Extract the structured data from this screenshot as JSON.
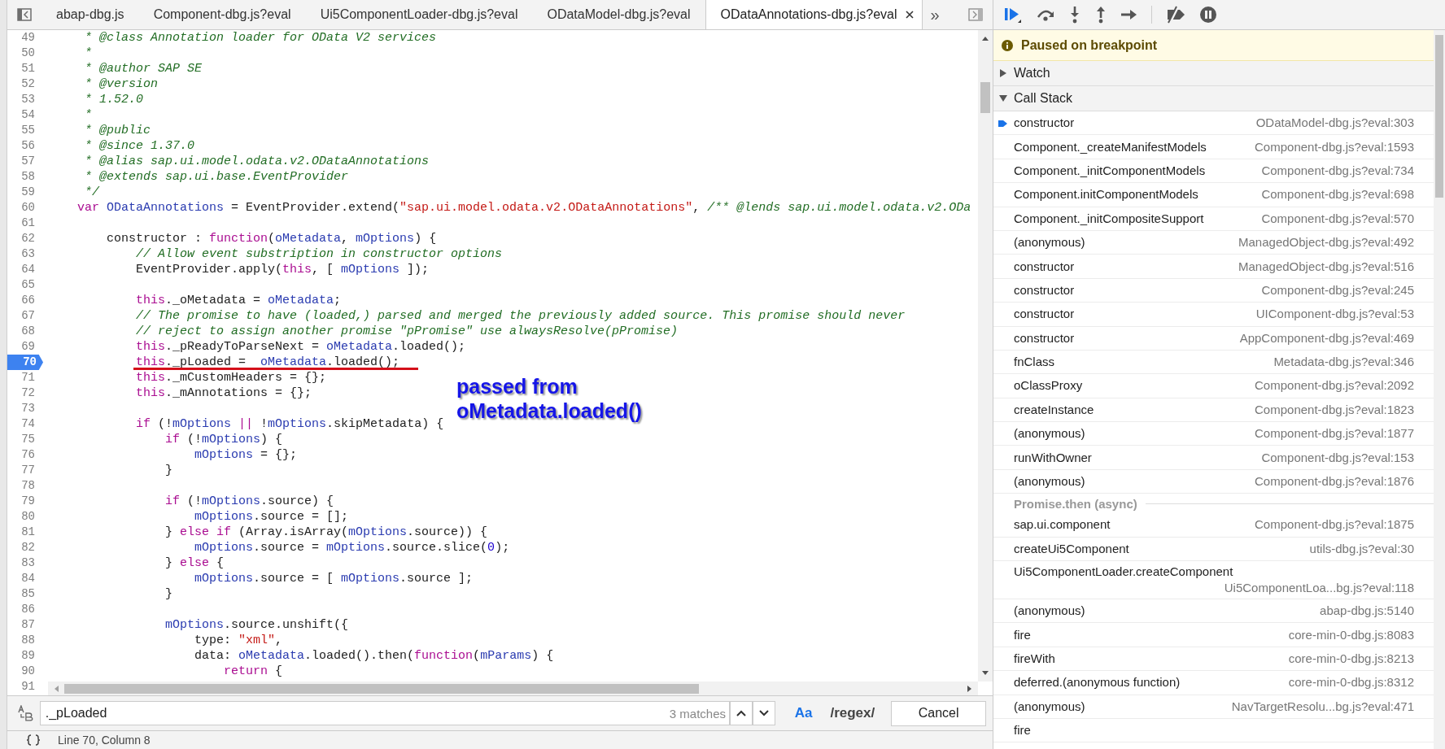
{
  "tabs": [
    {
      "label": "abap-dbg.js",
      "selected": false
    },
    {
      "label": "Component-dbg.js?eval",
      "selected": false
    },
    {
      "label": "Ui5ComponentLoader-dbg.js?eval",
      "selected": false
    },
    {
      "label": "ODataModel-dbg.js?eval",
      "selected": false
    },
    {
      "label": "ODataAnnotations-dbg.js?eval",
      "selected": true
    }
  ],
  "tab_overflow": "»",
  "editor": {
    "lines": [
      {
        "number": "49",
        "breakpoint": false,
        "tokens": [
          {
            "kind": "comment",
            "text": "     * @class Annotation loader for OData V2 services"
          }
        ]
      },
      {
        "number": "50",
        "breakpoint": false,
        "tokens": [
          {
            "kind": "comment",
            "text": "     *"
          }
        ]
      },
      {
        "number": "51",
        "breakpoint": false,
        "tokens": [
          {
            "kind": "comment",
            "text": "     * @author SAP SE"
          }
        ]
      },
      {
        "number": "52",
        "breakpoint": false,
        "tokens": [
          {
            "kind": "comment",
            "text": "     * @version"
          }
        ]
      },
      {
        "number": "53",
        "breakpoint": false,
        "tokens": [
          {
            "kind": "comment",
            "text": "     * 1.52.0"
          }
        ]
      },
      {
        "number": "54",
        "breakpoint": false,
        "tokens": [
          {
            "kind": "comment",
            "text": "     *"
          }
        ]
      },
      {
        "number": "55",
        "breakpoint": false,
        "tokens": [
          {
            "kind": "comment",
            "text": "     * @public"
          }
        ]
      },
      {
        "number": "56",
        "breakpoint": false,
        "tokens": [
          {
            "kind": "comment",
            "text": "     * @since 1.37.0"
          }
        ]
      },
      {
        "number": "57",
        "breakpoint": false,
        "tokens": [
          {
            "kind": "comment",
            "text": "     * @alias sap.ui.model.odata.v2.ODataAnnotations"
          }
        ]
      },
      {
        "number": "58",
        "breakpoint": false,
        "tokens": [
          {
            "kind": "comment",
            "text": "     * @extends sap.ui.base.EventProvider"
          }
        ]
      },
      {
        "number": "59",
        "breakpoint": false,
        "tokens": [
          {
            "kind": "comment",
            "text": "     */"
          }
        ]
      },
      {
        "number": "60",
        "breakpoint": false,
        "tokens": [
          {
            "kind": "keyword",
            "text": "    var "
          },
          {
            "kind": "variable",
            "text": "ODataAnnotations"
          },
          {
            "kind": "plain",
            "text": " = EventProvider.extend("
          },
          {
            "kind": "string",
            "text": "\"sap.ui.model.odata.v2.ODataAnnotations\""
          },
          {
            "kind": "plain",
            "text": ", "
          },
          {
            "kind": "comment",
            "text": "/** @lends sap.ui.model.odata.v2.ODa"
          }
        ]
      },
      {
        "number": "61",
        "breakpoint": false
      },
      {
        "number": "62",
        "breakpoint": false,
        "tokens": [
          {
            "kind": "plain",
            "text": "        constructor : "
          },
          {
            "kind": "keyword",
            "text": "function"
          },
          {
            "kind": "plain",
            "text": "("
          },
          {
            "kind": "variable",
            "text": "oMetadata"
          },
          {
            "kind": "plain",
            "text": ", "
          },
          {
            "kind": "variable",
            "text": "mOptions"
          },
          {
            "kind": "plain",
            "text": ") {"
          }
        ]
      },
      {
        "number": "63",
        "breakpoint": false,
        "tokens": [
          {
            "kind": "comment",
            "text": "            // Allow event substription in constructor options"
          }
        ]
      },
      {
        "number": "64",
        "breakpoint": false,
        "tokens": [
          {
            "kind": "plain",
            "text": "            EventProvider.apply("
          },
          {
            "kind": "keyword",
            "text": "this"
          },
          {
            "kind": "plain",
            "text": ", [ "
          },
          {
            "kind": "variable",
            "text": "mOptions"
          },
          {
            "kind": "plain",
            "text": " ]);"
          }
        ]
      },
      {
        "number": "65",
        "breakpoint": false
      },
      {
        "number": "66",
        "breakpoint": false,
        "tokens": [
          {
            "kind": "keyword",
            "text": "            this"
          },
          {
            "kind": "plain",
            "text": "._oMetadata = "
          },
          {
            "kind": "variable",
            "text": "oMetadata"
          },
          {
            "kind": "plain",
            "text": ";"
          }
        ]
      },
      {
        "number": "67",
        "breakpoint": false,
        "tokens": [
          {
            "kind": "comment",
            "text": "            // The promise to have (loaded,) parsed and merged the previously added source. This promise should never"
          }
        ]
      },
      {
        "number": "68",
        "breakpoint": false,
        "tokens": [
          {
            "kind": "comment",
            "text": "            // reject to assign another promise \"pPromise\" use alwaysResolve(pPromise)"
          }
        ]
      },
      {
        "number": "69",
        "breakpoint": false,
        "tokens": [
          {
            "kind": "keyword",
            "text": "            this"
          },
          {
            "kind": "plain",
            "text": "._pReadyToParseNext = "
          },
          {
            "kind": "variable",
            "text": "oMetadata"
          },
          {
            "kind": "plain",
            "text": ".loaded();"
          }
        ]
      },
      {
        "number": "70",
        "breakpoint": true,
        "underlined": true,
        "tokens": [
          {
            "kind": "keyword",
            "text": "            this"
          },
          {
            "kind": "plain",
            "text": "._pLoaded =  "
          },
          {
            "kind": "variable",
            "text": "oMetadata"
          },
          {
            "kind": "plain",
            "text": ".loaded();"
          }
        ]
      },
      {
        "number": "71",
        "breakpoint": false,
        "tokens": [
          {
            "kind": "keyword",
            "text": "            this"
          },
          {
            "kind": "plain",
            "text": "._mCustomHeaders = {};"
          }
        ]
      },
      {
        "number": "72",
        "breakpoint": false,
        "tokens": [
          {
            "kind": "keyword",
            "text": "            this"
          },
          {
            "kind": "plain",
            "text": "._mAnnotations = {};"
          }
        ]
      },
      {
        "number": "73",
        "breakpoint": false
      },
      {
        "number": "74",
        "breakpoint": false,
        "tokens": [
          {
            "kind": "keyword",
            "text": "            if"
          },
          {
            "kind": "plain",
            "text": " (!"
          },
          {
            "kind": "variable",
            "text": "mOptions"
          },
          {
            "kind": "keyword",
            "text": " ||"
          },
          {
            "kind": "plain",
            "text": " !"
          },
          {
            "kind": "variable",
            "text": "mOptions"
          },
          {
            "kind": "plain",
            "text": ".skipMetadata) {"
          }
        ]
      },
      {
        "number": "75",
        "breakpoint": false,
        "tokens": [
          {
            "kind": "keyword",
            "text": "                if"
          },
          {
            "kind": "plain",
            "text": " (!"
          },
          {
            "kind": "variable",
            "text": "mOptions"
          },
          {
            "kind": "plain",
            "text": ") {"
          }
        ]
      },
      {
        "number": "76",
        "breakpoint": false,
        "tokens": [
          {
            "kind": "variable",
            "text": "                    mOptions"
          },
          {
            "kind": "plain",
            "text": " = {};"
          }
        ]
      },
      {
        "number": "77",
        "breakpoint": false,
        "tokens": [
          {
            "kind": "plain",
            "text": "                }"
          }
        ]
      },
      {
        "number": "78",
        "breakpoint": false
      },
      {
        "number": "79",
        "breakpoint": false,
        "tokens": [
          {
            "kind": "keyword",
            "text": "                if"
          },
          {
            "kind": "plain",
            "text": " (!"
          },
          {
            "kind": "variable",
            "text": "mOptions"
          },
          {
            "kind": "plain",
            "text": ".source) {"
          }
        ]
      },
      {
        "number": "80",
        "breakpoint": false,
        "tokens": [
          {
            "kind": "variable",
            "text": "                    mOptions"
          },
          {
            "kind": "plain",
            "text": ".source = [];"
          }
        ]
      },
      {
        "number": "81",
        "breakpoint": false,
        "tokens": [
          {
            "kind": "plain",
            "text": "                } "
          },
          {
            "kind": "keyword",
            "text": "else if"
          },
          {
            "kind": "plain",
            "text": " (Array.isArray("
          },
          {
            "kind": "variable",
            "text": "mOptions"
          },
          {
            "kind": "plain",
            "text": ".source)) {"
          }
        ]
      },
      {
        "number": "82",
        "breakpoint": false,
        "tokens": [
          {
            "kind": "variable",
            "text": "                    mOptions"
          },
          {
            "kind": "plain",
            "text": ".source = "
          },
          {
            "kind": "variable",
            "text": "mOptions"
          },
          {
            "kind": "plain",
            "text": ".source.slice("
          },
          {
            "kind": "number",
            "text": "0"
          },
          {
            "kind": "plain",
            "text": ");"
          }
        ]
      },
      {
        "number": "83",
        "breakpoint": false,
        "tokens": [
          {
            "kind": "plain",
            "text": "                } "
          },
          {
            "kind": "keyword",
            "text": "else"
          },
          {
            "kind": "plain",
            "text": " {"
          }
        ]
      },
      {
        "number": "84",
        "breakpoint": false,
        "tokens": [
          {
            "kind": "variable",
            "text": "                    mOptions"
          },
          {
            "kind": "plain",
            "text": ".source = [ "
          },
          {
            "kind": "variable",
            "text": "mOptions"
          },
          {
            "kind": "plain",
            "text": ".source ];"
          }
        ]
      },
      {
        "number": "85",
        "breakpoint": false,
        "tokens": [
          {
            "kind": "plain",
            "text": "                }"
          }
        ]
      },
      {
        "number": "86",
        "breakpoint": false
      },
      {
        "number": "87",
        "breakpoint": false,
        "tokens": [
          {
            "kind": "variable",
            "text": "                mOptions"
          },
          {
            "kind": "plain",
            "text": ".source.unshift({"
          }
        ]
      },
      {
        "number": "88",
        "breakpoint": false,
        "tokens": [
          {
            "kind": "plain",
            "text": "                    type: "
          },
          {
            "kind": "string",
            "text": "\"xml\""
          },
          {
            "kind": "plain",
            "text": ","
          }
        ]
      },
      {
        "number": "89",
        "breakpoint": false,
        "tokens": [
          {
            "kind": "plain",
            "text": "                    data: "
          },
          {
            "kind": "variable",
            "text": "oMetadata"
          },
          {
            "kind": "plain",
            "text": ".loaded().then("
          },
          {
            "kind": "keyword",
            "text": "function"
          },
          {
            "kind": "plain",
            "text": "("
          },
          {
            "kind": "variable",
            "text": "mParams"
          },
          {
            "kind": "plain",
            "text": ") {"
          }
        ]
      },
      {
        "number": "90",
        "breakpoint": false,
        "tokens": [
          {
            "kind": "keyword",
            "text": "                        return"
          },
          {
            "kind": "plain",
            "text": " {"
          }
        ]
      },
      {
        "number": "91",
        "breakpoint": false
      }
    ],
    "annotation": [
      "passed from",
      "oMetadata.loaded()"
    ]
  },
  "search": {
    "value": "._pLoaded",
    "match_count": "3 matches",
    "case_label": "Aa",
    "regex_label": "/regex/",
    "cancel_label": "Cancel"
  },
  "status_bar": {
    "position": "Line 70, Column 8"
  },
  "debugger": {
    "banner": "Paused on breakpoint",
    "sections": [
      {
        "label": "Watch",
        "expanded": false
      },
      {
        "label": "Call Stack",
        "expanded": true
      }
    ],
    "call_stack": [
      {
        "kind": "frame",
        "name": "constructor",
        "location": "ODataModel-dbg.js?eval:303",
        "selected": true
      },
      {
        "kind": "frame",
        "name": "Component._createManifestModels",
        "location": "Component-dbg.js?eval:1593",
        "selected": false
      },
      {
        "kind": "frame",
        "name": "Component._initComponentModels",
        "location": "Component-dbg.js?eval:734",
        "selected": false
      },
      {
        "kind": "frame",
        "name": "Component.initComponentModels",
        "location": "Component-dbg.js?eval:698",
        "selected": false
      },
      {
        "kind": "frame",
        "name": "Component._initCompositeSupport",
        "location": "Component-dbg.js?eval:570",
        "selected": false
      },
      {
        "kind": "frame",
        "name": "(anonymous)",
        "location": "ManagedObject-dbg.js?eval:492",
        "selected": false
      },
      {
        "kind": "frame",
        "name": "constructor",
        "location": "ManagedObject-dbg.js?eval:516",
        "selected": false
      },
      {
        "kind": "frame",
        "name": "constructor",
        "location": "Component-dbg.js?eval:245",
        "selected": false
      },
      {
        "kind": "frame",
        "name": "constructor",
        "location": "UIComponent-dbg.js?eval:53",
        "selected": false
      },
      {
        "kind": "frame",
        "name": "constructor",
        "location": "AppComponent-dbg.js?eval:469",
        "selected": false
      },
      {
        "kind": "frame",
        "name": "fnClass",
        "location": "Metadata-dbg.js?eval:346",
        "selected": false
      },
      {
        "kind": "frame",
        "name": "oClassProxy",
        "location": "Component-dbg.js?eval:2092",
        "selected": false
      },
      {
        "kind": "frame",
        "name": "createInstance",
        "location": "Component-dbg.js?eval:1823",
        "selected": false
      },
      {
        "kind": "frame",
        "name": "(anonymous)",
        "location": "Component-dbg.js?eval:1877",
        "selected": false
      },
      {
        "kind": "frame",
        "name": "runWithOwner",
        "location": "Component-dbg.js?eval:153",
        "selected": false
      },
      {
        "kind": "frame",
        "name": "(anonymous)",
        "location": "Component-dbg.js?eval:1876",
        "selected": false
      },
      {
        "kind": "separator",
        "name": "Promise.then (async)"
      },
      {
        "kind": "frame",
        "name": "sap.ui.component",
        "location": "Component-dbg.js?eval:1875",
        "selected": false
      },
      {
        "kind": "frame",
        "name": "createUi5Component",
        "location": "utils-dbg.js?eval:30",
        "selected": false
      },
      {
        "kind": "frame",
        "name": "Ui5ComponentLoader.createComponent",
        "location": "Ui5ComponentLoa...bg.js?eval:118",
        "selected": false
      },
      {
        "kind": "frame",
        "name": "(anonymous)",
        "location": "abap-dbg.js:5140",
        "selected": false
      },
      {
        "kind": "frame",
        "name": "fire",
        "location": "core-min-0-dbg.js:8083",
        "selected": false
      },
      {
        "kind": "frame",
        "name": "fireWith",
        "location": "core-min-0-dbg.js:8213",
        "selected": false
      },
      {
        "kind": "frame",
        "name": "deferred.(anonymous function)",
        "location": "core-min-0-dbg.js:8312",
        "selected": false
      },
      {
        "kind": "frame",
        "name": "(anonymous)",
        "location": "NavTargetResolu...bg.js?eval:471",
        "selected": false
      },
      {
        "kind": "frame",
        "name": "fire",
        "selected": false
      }
    ]
  }
}
